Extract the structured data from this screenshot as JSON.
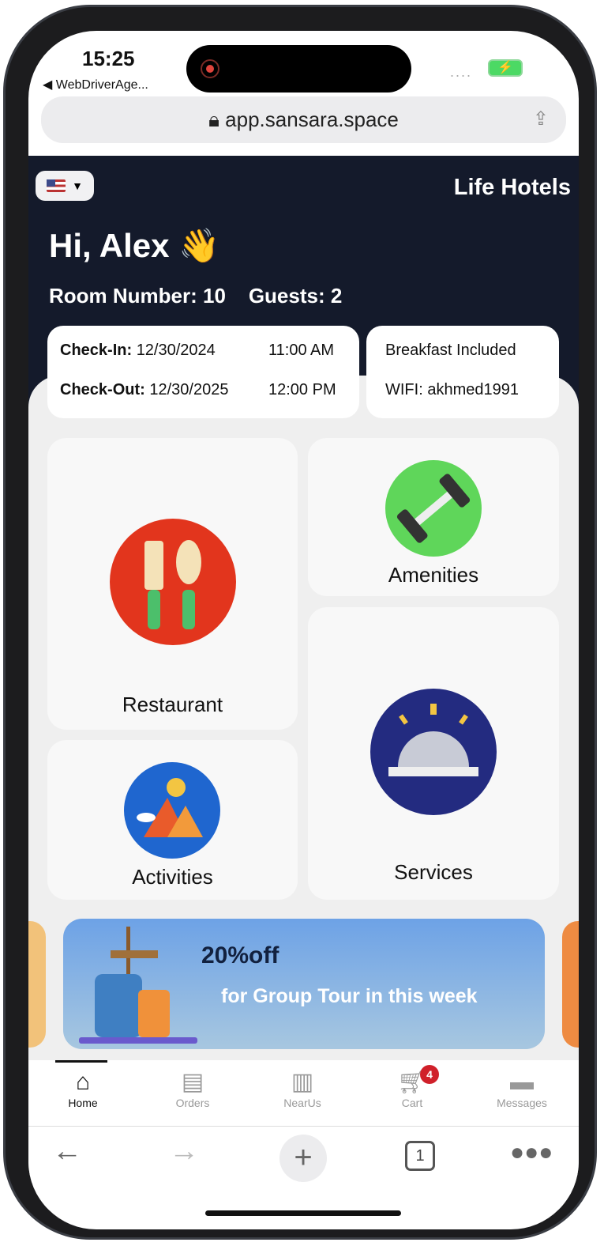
{
  "status": {
    "time": "15:25",
    "back_app": "◀ WebDriverAge...",
    "signal": "....",
    "battery_icon": "battery-charging-icon"
  },
  "browser": {
    "url": "app.sansara.space",
    "tabs_count": "1"
  },
  "header": {
    "language": "en-US",
    "brand": "Life Hotels",
    "greeting": "Hi, Alex 👋",
    "room": "Room Number: 10",
    "guests": "Guests: 2"
  },
  "stay": {
    "checkin_label": "Check-In:",
    "checkin_date": "12/30/2024",
    "checkin_time": "11:00 AM",
    "checkout_label": "Check-Out:",
    "checkout_date": "12/30/2025",
    "checkout_time": "12:00 PM",
    "breakfast": "Breakfast Included",
    "wifi": "WIFI: akhmed1991"
  },
  "tiles": [
    {
      "label": "Restaurant",
      "icon": "fork-spoon-icon",
      "color": "#e2351d"
    },
    {
      "label": "Amenities",
      "icon": "dumbbell-icon",
      "color": "#5fd65a"
    },
    {
      "label": "Activities",
      "icon": "mountain-pin-icon",
      "color": "#1f66cf"
    },
    {
      "label": "Services",
      "icon": "service-bell-icon",
      "color": "#232b80"
    }
  ],
  "banner": {
    "title": "20%off",
    "subtitle": "for Group Tour in this week"
  },
  "tabbar": [
    {
      "label": "Home",
      "active": true
    },
    {
      "label": "Orders"
    },
    {
      "label": "NearUs"
    },
    {
      "label": "Cart",
      "badge": "4"
    },
    {
      "label": "Messages"
    }
  ],
  "colors": {
    "header_bg": "#141a2b",
    "badge": "#d0202a"
  }
}
